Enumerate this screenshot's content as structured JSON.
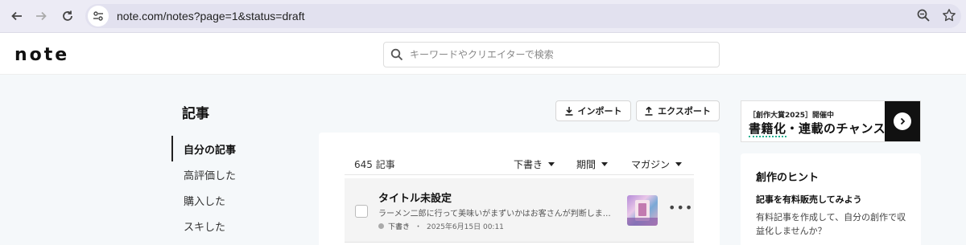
{
  "browser": {
    "url": "note.com/notes?page=1&status=draft",
    "back_icon": "arrow-left-icon",
    "forward_icon": "arrow-right-icon",
    "reload_icon": "reload-icon",
    "site_info_icon": "tune-icon",
    "zoom_icon": "zoom-icon",
    "bookmark_icon": "star-icon"
  },
  "header": {
    "logo": "note",
    "search_placeholder": "キーワードやクリエイターで検索"
  },
  "page": {
    "title": "記事"
  },
  "sidenav": {
    "items": [
      {
        "label": "自分の記事",
        "active": true
      },
      {
        "label": "高評価した",
        "active": false
      },
      {
        "label": "購入した",
        "active": false
      },
      {
        "label": "スキした",
        "active": false
      }
    ]
  },
  "toolbar": {
    "import_label": "インポート",
    "export_label": "エクスポート"
  },
  "list": {
    "count": "645 記事",
    "filters": {
      "status": "下書き",
      "period": "期間",
      "magazine": "マガジン"
    }
  },
  "articles": [
    {
      "title": "タイトル未設定",
      "excerpt": "ラーメン二郎に行って美味いがまずいかはお客さんが判断しますが...",
      "status": "下書き",
      "date": "2025年6月15日 00:11",
      "more": "•••"
    }
  ],
  "banner": {
    "small": "［創作大賞2025］開催中",
    "main_underlined": "書籍化",
    "main_rest": "・連載のチャンス"
  },
  "hints": {
    "title": "創作のヒント",
    "subtitle": "記事を有料販売してみよう",
    "body": "有料記事を作成して、自分の創作で収益化しませんか？"
  },
  "colors": {
    "accent_underline": "#23b08f",
    "background": "#f5f8fa",
    "banner_dark": "#111111"
  }
}
